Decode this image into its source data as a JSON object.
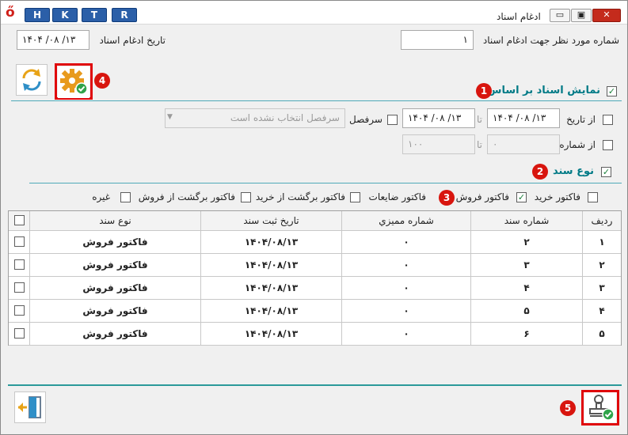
{
  "titlebar": {
    "logo": "ő",
    "tabs": [
      "H",
      "K",
      "T",
      "R"
    ],
    "title": "ادغام اسناد",
    "minimize": "▭",
    "maximize": "▣",
    "close": "✕"
  },
  "top": {
    "target_doc_label": "شماره مورد نظر جهت ادغام اسناد",
    "target_doc_value": "۱",
    "merge_date_label": "تاریخ ادغام اسناد",
    "merge_date_value": "۱۴۰۴ /۰۸ /۱۳"
  },
  "toolbar": {
    "refresh": "refresh-icon",
    "settings": "settings-gear-icon"
  },
  "filter": {
    "title": "نمایش اسناد بر اساس",
    "from_date_label": "از تاریخ",
    "from_date_value": "۱۴۰۴ /۰۸ /۱۳",
    "to_label": "تا",
    "to_date_value": "۱۴۰۴ /۰۸ /۱۳",
    "heading_label": "سرفصل",
    "heading_value": "سرفصل انتخاب نشده است",
    "from_number_label": "از شماره",
    "from_number_value": "۰",
    "to_number_label": "تا",
    "to_number_value": "۱۰۰"
  },
  "doc_type": {
    "title": "نوع سند",
    "options": [
      {
        "label": "فاکتور خرید",
        "checked": false
      },
      {
        "label": "فاکتور فروش",
        "checked": true
      },
      {
        "label": "فاکتور ضایعات",
        "checked": false
      },
      {
        "label": "فاکتور برگشت از خرید",
        "checked": false
      },
      {
        "label": "فاکتور برگشت از فروش",
        "checked": false
      },
      {
        "label": "غیره",
        "checked": false
      }
    ]
  },
  "table": {
    "headers": {
      "row": "ردیف",
      "doc_no": "شماره سند",
      "audit_no": "شماره مميزي",
      "reg_date": "تاریخ ثبت سند",
      "doc_type": "نوع سند"
    },
    "rows": [
      {
        "row": "۱",
        "doc_no": "۲",
        "audit_no": "۰",
        "reg_date": "۱۴۰۴/۰۸/۱۳",
        "doc_type": "فاکتور فروش",
        "checked": false
      },
      {
        "row": "۲",
        "doc_no": "۳",
        "audit_no": "۰",
        "reg_date": "۱۴۰۴/۰۸/۱۳",
        "doc_type": "فاکتور فروش",
        "checked": false
      },
      {
        "row": "۳",
        "doc_no": "۴",
        "audit_no": "۰",
        "reg_date": "۱۴۰۴/۰۸/۱۳",
        "doc_type": "فاکتور فروش",
        "checked": false
      },
      {
        "row": "۴",
        "doc_no": "۵",
        "audit_no": "۰",
        "reg_date": "۱۴۰۴/۰۸/۱۳",
        "doc_type": "فاکتور فروش",
        "checked": false
      },
      {
        "row": "۵",
        "doc_no": "۶",
        "audit_no": "۰",
        "reg_date": "۱۴۰۴/۰۸/۱۳",
        "doc_type": "فاکتور فروش",
        "checked": false
      }
    ]
  },
  "annotations": [
    "1",
    "2",
    "3",
    "4",
    "5"
  ],
  "bottom": {
    "exit": "exit-door-icon",
    "stamp": "stamp-confirm-icon"
  }
}
